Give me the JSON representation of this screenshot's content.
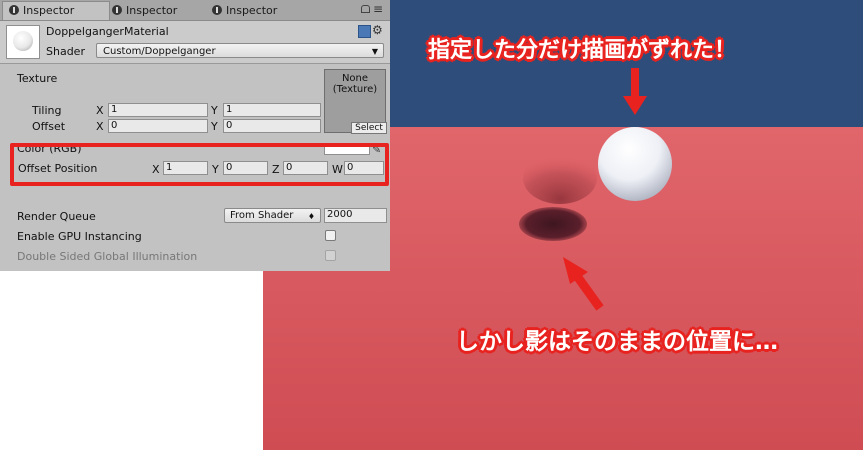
{
  "tabs": [
    {
      "label": "Inspector"
    },
    {
      "label": "Inspector"
    },
    {
      "label": "Inspector"
    }
  ],
  "header": {
    "material_name": "DoppelgangerMaterial",
    "shader_label": "Shader",
    "shader_value": "Custom/Doppelganger"
  },
  "texture": {
    "label": "Texture",
    "slot_text_line1": "None",
    "slot_text_line2": "(Texture)",
    "select_label": "Select",
    "tiling_label": "Tiling",
    "tiling_x": "1",
    "tiling_y": "1",
    "offset_label": "Offset",
    "offset_x": "0",
    "offset_y": "0"
  },
  "color": {
    "label": "Color (RGB)",
    "value": "#ffffff"
  },
  "offset_position": {
    "label": "Offset Position",
    "x": "1",
    "y": "0",
    "z": "0",
    "w": "0"
  },
  "axis_labels": {
    "x": "X",
    "y": "Y",
    "z": "Z",
    "w": "W"
  },
  "render_queue": {
    "label": "Render Queue",
    "mode": "From Shader",
    "value": "2000"
  },
  "gpu_instancing": {
    "label": "Enable GPU Instancing",
    "checked": false
  },
  "double_sided_gi": {
    "label": "Double Sided Global Illumination",
    "checked": false,
    "disabled": true
  },
  "annotations": {
    "top": "指定した分だけ描画がずれた！",
    "bottom": "しかし影はそのままの位置に…"
  },
  "colors": {
    "highlight": "#e8231f",
    "sky": "#2f4d7a",
    "ground": "#d9565c",
    "panel": "#c2c2c2"
  }
}
